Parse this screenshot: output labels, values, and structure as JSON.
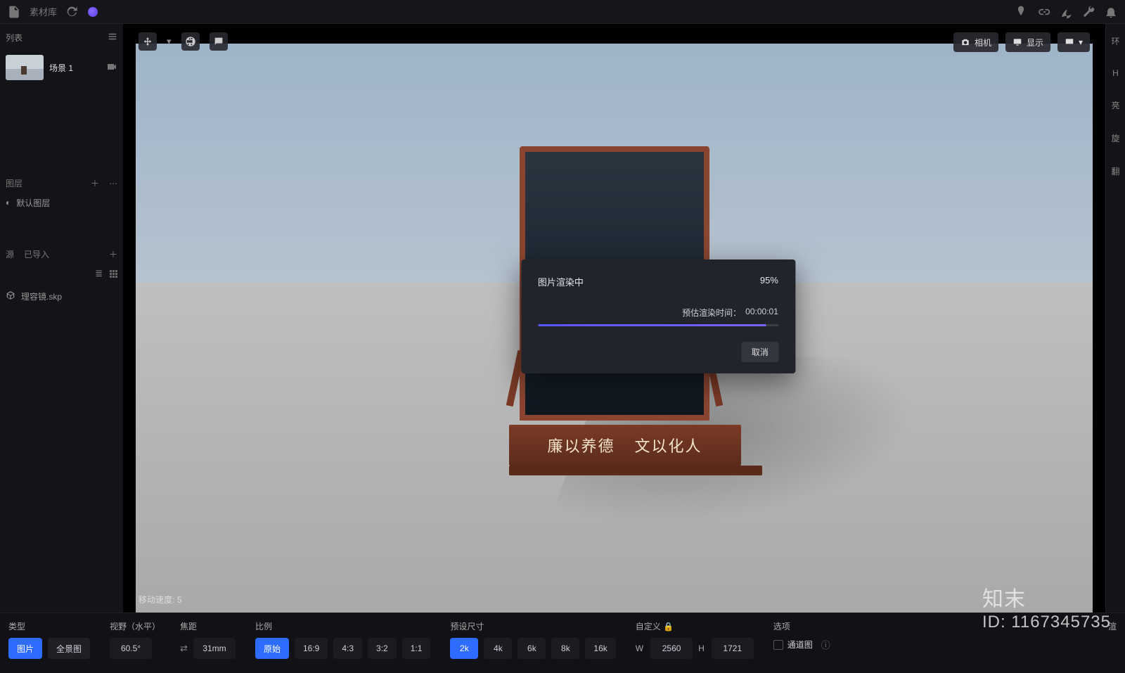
{
  "topbar": {
    "tab_label": "素材库",
    "icons": [
      "new-file",
      "library",
      "refresh",
      "purple-dot",
      "pin",
      "link",
      "leaf",
      "wrench",
      "bell"
    ]
  },
  "left_panel": {
    "list_header": "列表",
    "scene_name": "场景 1",
    "layer_default": "默认图层",
    "source_label": "源",
    "imported_label": "已导入",
    "file_item": "理容镜.skp"
  },
  "viewport": {
    "camera_btn": "相机",
    "display_btn": "显示",
    "move_speed_label": "移动速度:",
    "move_speed_value": "5",
    "base_text_left": "廉以养德",
    "base_text_right": "文以化人"
  },
  "dialog": {
    "title": "图片渲染中",
    "percent": "95%",
    "eta_label": "预估渲染时间：",
    "eta_value": "00:00:01",
    "progress_pct": 95,
    "cancel": "取消"
  },
  "right_panel": {
    "tabs": [
      "环",
      "H",
      "亮",
      "旋",
      "翻"
    ]
  },
  "bottom": {
    "type_label": "类型",
    "type_options": {
      "image": "图片",
      "pano": "全景图"
    },
    "fov_label": "视野（水平）",
    "fov_value": "60.5°",
    "focal_label": "焦距",
    "focal_value": "31mm",
    "ratio_label": "比例",
    "ratio_options": [
      "原始",
      "16:9",
      "4:3",
      "3:2",
      "1:1"
    ],
    "preset_label": "预设尺寸",
    "preset_options": [
      "2k",
      "4k",
      "6k",
      "8k",
      "16k"
    ],
    "custom_label": "自定义",
    "width_label": "W",
    "width_value": "2560",
    "height_label": "H",
    "height_value": "1721",
    "options_label": "选项",
    "channel_option": "通道图",
    "render_label": "渲"
  },
  "watermark": {
    "brand": "知末",
    "id": "ID: 1167345735"
  }
}
